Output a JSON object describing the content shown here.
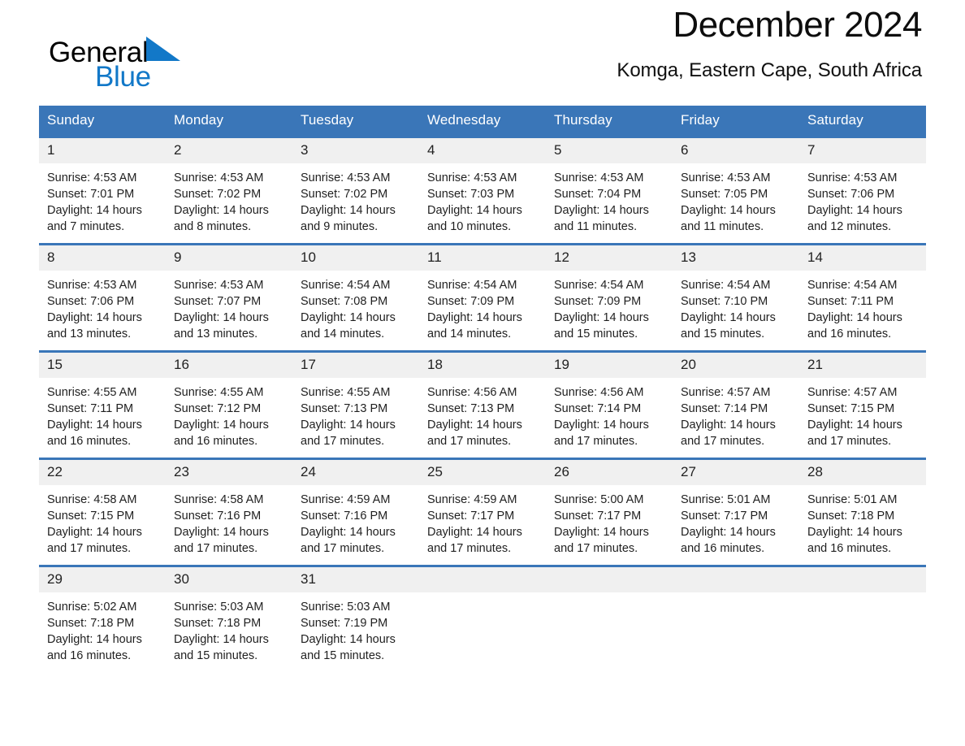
{
  "brand": {
    "name_part1": "General",
    "name_part2": "Blue",
    "logo_icon": "triangle-logo-icon",
    "accent_color": "#1278c8"
  },
  "header": {
    "title": "December 2024",
    "subtitle": "Komga, Eastern Cape, South Africa"
  },
  "theme": {
    "header_blue": "#3a76b8",
    "daynum_bg": "#f0f0f0",
    "text": "#1f1f1f"
  },
  "weekday_headers": [
    "Sunday",
    "Monday",
    "Tuesday",
    "Wednesday",
    "Thursday",
    "Friday",
    "Saturday"
  ],
  "days": [
    {
      "date": "1",
      "sunrise": "Sunrise: 4:53 AM",
      "sunset": "Sunset: 7:01 PM",
      "daylight": "Daylight: 14 hours and 7 minutes."
    },
    {
      "date": "2",
      "sunrise": "Sunrise: 4:53 AM",
      "sunset": "Sunset: 7:02 PM",
      "daylight": "Daylight: 14 hours and 8 minutes."
    },
    {
      "date": "3",
      "sunrise": "Sunrise: 4:53 AM",
      "sunset": "Sunset: 7:02 PM",
      "daylight": "Daylight: 14 hours and 9 minutes."
    },
    {
      "date": "4",
      "sunrise": "Sunrise: 4:53 AM",
      "sunset": "Sunset: 7:03 PM",
      "daylight": "Daylight: 14 hours and 10 minutes."
    },
    {
      "date": "5",
      "sunrise": "Sunrise: 4:53 AM",
      "sunset": "Sunset: 7:04 PM",
      "daylight": "Daylight: 14 hours and 11 minutes."
    },
    {
      "date": "6",
      "sunrise": "Sunrise: 4:53 AM",
      "sunset": "Sunset: 7:05 PM",
      "daylight": "Daylight: 14 hours and 11 minutes."
    },
    {
      "date": "7",
      "sunrise": "Sunrise: 4:53 AM",
      "sunset": "Sunset: 7:06 PM",
      "daylight": "Daylight: 14 hours and 12 minutes."
    },
    {
      "date": "8",
      "sunrise": "Sunrise: 4:53 AM",
      "sunset": "Sunset: 7:06 PM",
      "daylight": "Daylight: 14 hours and 13 minutes."
    },
    {
      "date": "9",
      "sunrise": "Sunrise: 4:53 AM",
      "sunset": "Sunset: 7:07 PM",
      "daylight": "Daylight: 14 hours and 13 minutes."
    },
    {
      "date": "10",
      "sunrise": "Sunrise: 4:54 AM",
      "sunset": "Sunset: 7:08 PM",
      "daylight": "Daylight: 14 hours and 14 minutes."
    },
    {
      "date": "11",
      "sunrise": "Sunrise: 4:54 AM",
      "sunset": "Sunset: 7:09 PM",
      "daylight": "Daylight: 14 hours and 14 minutes."
    },
    {
      "date": "12",
      "sunrise": "Sunrise: 4:54 AM",
      "sunset": "Sunset: 7:09 PM",
      "daylight": "Daylight: 14 hours and 15 minutes."
    },
    {
      "date": "13",
      "sunrise": "Sunrise: 4:54 AM",
      "sunset": "Sunset: 7:10 PM",
      "daylight": "Daylight: 14 hours and 15 minutes."
    },
    {
      "date": "14",
      "sunrise": "Sunrise: 4:54 AM",
      "sunset": "Sunset: 7:11 PM",
      "daylight": "Daylight: 14 hours and 16 minutes."
    },
    {
      "date": "15",
      "sunrise": "Sunrise: 4:55 AM",
      "sunset": "Sunset: 7:11 PM",
      "daylight": "Daylight: 14 hours and 16 minutes."
    },
    {
      "date": "16",
      "sunrise": "Sunrise: 4:55 AM",
      "sunset": "Sunset: 7:12 PM",
      "daylight": "Daylight: 14 hours and 16 minutes."
    },
    {
      "date": "17",
      "sunrise": "Sunrise: 4:55 AM",
      "sunset": "Sunset: 7:13 PM",
      "daylight": "Daylight: 14 hours and 17 minutes."
    },
    {
      "date": "18",
      "sunrise": "Sunrise: 4:56 AM",
      "sunset": "Sunset: 7:13 PM",
      "daylight": "Daylight: 14 hours and 17 minutes."
    },
    {
      "date": "19",
      "sunrise": "Sunrise: 4:56 AM",
      "sunset": "Sunset: 7:14 PM",
      "daylight": "Daylight: 14 hours and 17 minutes."
    },
    {
      "date": "20",
      "sunrise": "Sunrise: 4:57 AM",
      "sunset": "Sunset: 7:14 PM",
      "daylight": "Daylight: 14 hours and 17 minutes."
    },
    {
      "date": "21",
      "sunrise": "Sunrise: 4:57 AM",
      "sunset": "Sunset: 7:15 PM",
      "daylight": "Daylight: 14 hours and 17 minutes."
    },
    {
      "date": "22",
      "sunrise": "Sunrise: 4:58 AM",
      "sunset": "Sunset: 7:15 PM",
      "daylight": "Daylight: 14 hours and 17 minutes."
    },
    {
      "date": "23",
      "sunrise": "Sunrise: 4:58 AM",
      "sunset": "Sunset: 7:16 PM",
      "daylight": "Daylight: 14 hours and 17 minutes."
    },
    {
      "date": "24",
      "sunrise": "Sunrise: 4:59 AM",
      "sunset": "Sunset: 7:16 PM",
      "daylight": "Daylight: 14 hours and 17 minutes."
    },
    {
      "date": "25",
      "sunrise": "Sunrise: 4:59 AM",
      "sunset": "Sunset: 7:17 PM",
      "daylight": "Daylight: 14 hours and 17 minutes."
    },
    {
      "date": "26",
      "sunrise": "Sunrise: 5:00 AM",
      "sunset": "Sunset: 7:17 PM",
      "daylight": "Daylight: 14 hours and 17 minutes."
    },
    {
      "date": "27",
      "sunrise": "Sunrise: 5:01 AM",
      "sunset": "Sunset: 7:17 PM",
      "daylight": "Daylight: 14 hours and 16 minutes."
    },
    {
      "date": "28",
      "sunrise": "Sunrise: 5:01 AM",
      "sunset": "Sunset: 7:18 PM",
      "daylight": "Daylight: 14 hours and 16 minutes."
    },
    {
      "date": "29",
      "sunrise": "Sunrise: 5:02 AM",
      "sunset": "Sunset: 7:18 PM",
      "daylight": "Daylight: 14 hours and 16 minutes."
    },
    {
      "date": "30",
      "sunrise": "Sunrise: 5:03 AM",
      "sunset": "Sunset: 7:18 PM",
      "daylight": "Daylight: 14 hours and 15 minutes."
    },
    {
      "date": "31",
      "sunrise": "Sunrise: 5:03 AM",
      "sunset": "Sunset: 7:19 PM",
      "daylight": "Daylight: 14 hours and 15 minutes."
    }
  ]
}
